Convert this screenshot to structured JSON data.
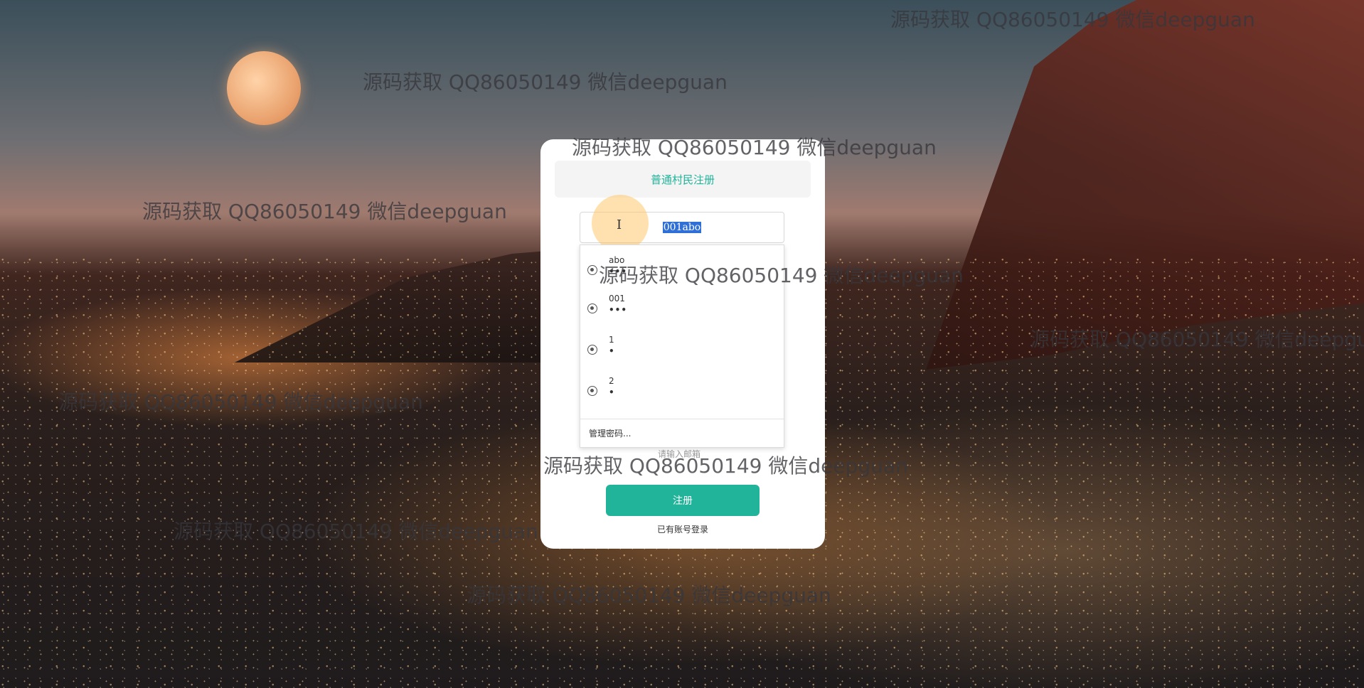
{
  "card": {
    "tab_label": "普通村民注册",
    "input_value": "001abo",
    "placeholder_below": "请输入邮箱",
    "register_button": "注册",
    "login_link": "已有账号登录"
  },
  "autocomplete": {
    "items": [
      {
        "user": "abo",
        "pass": "•••"
      },
      {
        "user": "001",
        "pass": "•••"
      },
      {
        "user": "1",
        "pass": "•"
      },
      {
        "user": "2",
        "pass": "•"
      }
    ],
    "manage_label": "管理密码..."
  },
  "watermark": {
    "text": "源码获取 QQ86050149 微信deepguan"
  },
  "colors": {
    "accent": "#22b49a",
    "selection": "#2f6fd6"
  }
}
